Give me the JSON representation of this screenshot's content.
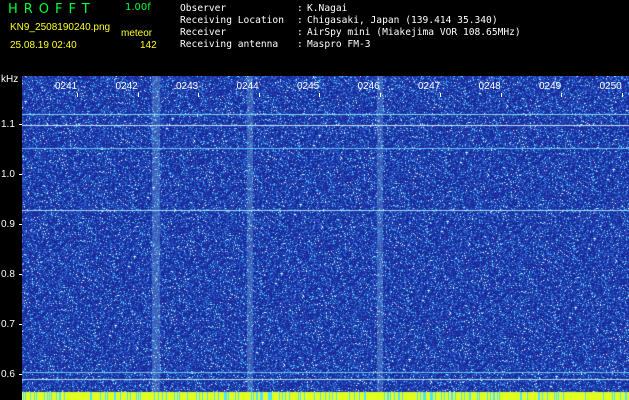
{
  "header": {
    "app_title": "HROFFT",
    "version": "1.00f",
    "filename": "KN9_2508190240.png",
    "mode": "meteor",
    "datetime": "25.08.19 02:40",
    "count": "142"
  },
  "info": [
    {
      "label": "Observer",
      "value": "K.Nagai"
    },
    {
      "label": "Receiving Location",
      "value": "Chigasaki, Japan (139.414 35.340)"
    },
    {
      "label": "Receiver",
      "value": "AirSpy mini (Miakejima VOR 108.65MHz)"
    },
    {
      "label": "Receiving antenna",
      "value": "Maspro FM-3"
    }
  ],
  "spectrogram": {
    "unit": "kHz",
    "freq_labels": [
      "1.1",
      "1.0",
      "0.9",
      "0.8",
      "0.7",
      "0.6"
    ],
    "time_labels": [
      "0241",
      "0242",
      "0243",
      "0244",
      "0245",
      "0246",
      "0247",
      "0248",
      "0249",
      "0250"
    ],
    "colors": {
      "background": "#1a2a9c",
      "noise": "#3a7ad8",
      "signal": "#4fe0ff",
      "hot": "#ffffff",
      "bottom_bar": "#e0ff20"
    }
  }
}
